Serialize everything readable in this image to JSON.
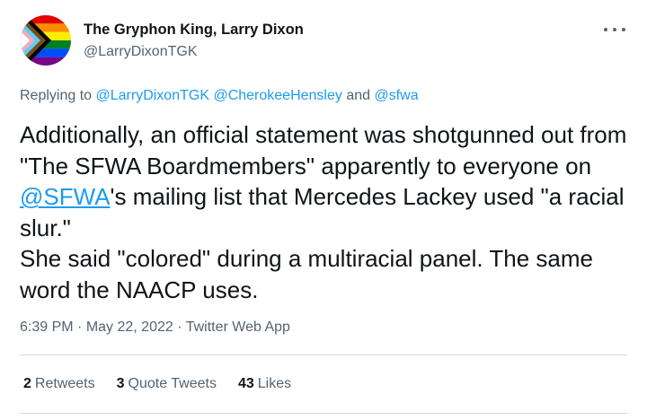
{
  "author": {
    "name": "The Gryphon King, Larry Dixon",
    "handle": "@LarryDixonTGK",
    "avatar_icon": "progress-pride-flag-icon"
  },
  "reply": {
    "prefix": "Replying to ",
    "mentions": [
      "@LarryDixonTGK",
      "@CherokeeHensley",
      "@sfwa"
    ],
    "and": " and ",
    "space": " "
  },
  "tweet": {
    "line_part1": "Additionally, an official statement was shotgunned out from \"The SFWA Boardmembers\" apparently to everyone on ",
    "mention": "@SFWA",
    "line_part2": "'s mailing list that Mercedes Lackey used \"a racial slur.\"",
    "line_part3": "She said \"colored\" during a multiracial panel. The same word the NAACP uses."
  },
  "meta": {
    "time": "6:39 PM",
    "sep": " · ",
    "date": "May 22, 2022",
    "source": "Twitter Web App"
  },
  "stats": {
    "retweets_count": "2",
    "retweets_label": "Retweets",
    "quotes_count": "3",
    "quotes_label": "Quote Tweets",
    "likes_count": "43",
    "likes_label": "Likes"
  },
  "colors": {
    "link": "#1d9bf0",
    "secondary": "#536471",
    "text": "#0f1419"
  }
}
